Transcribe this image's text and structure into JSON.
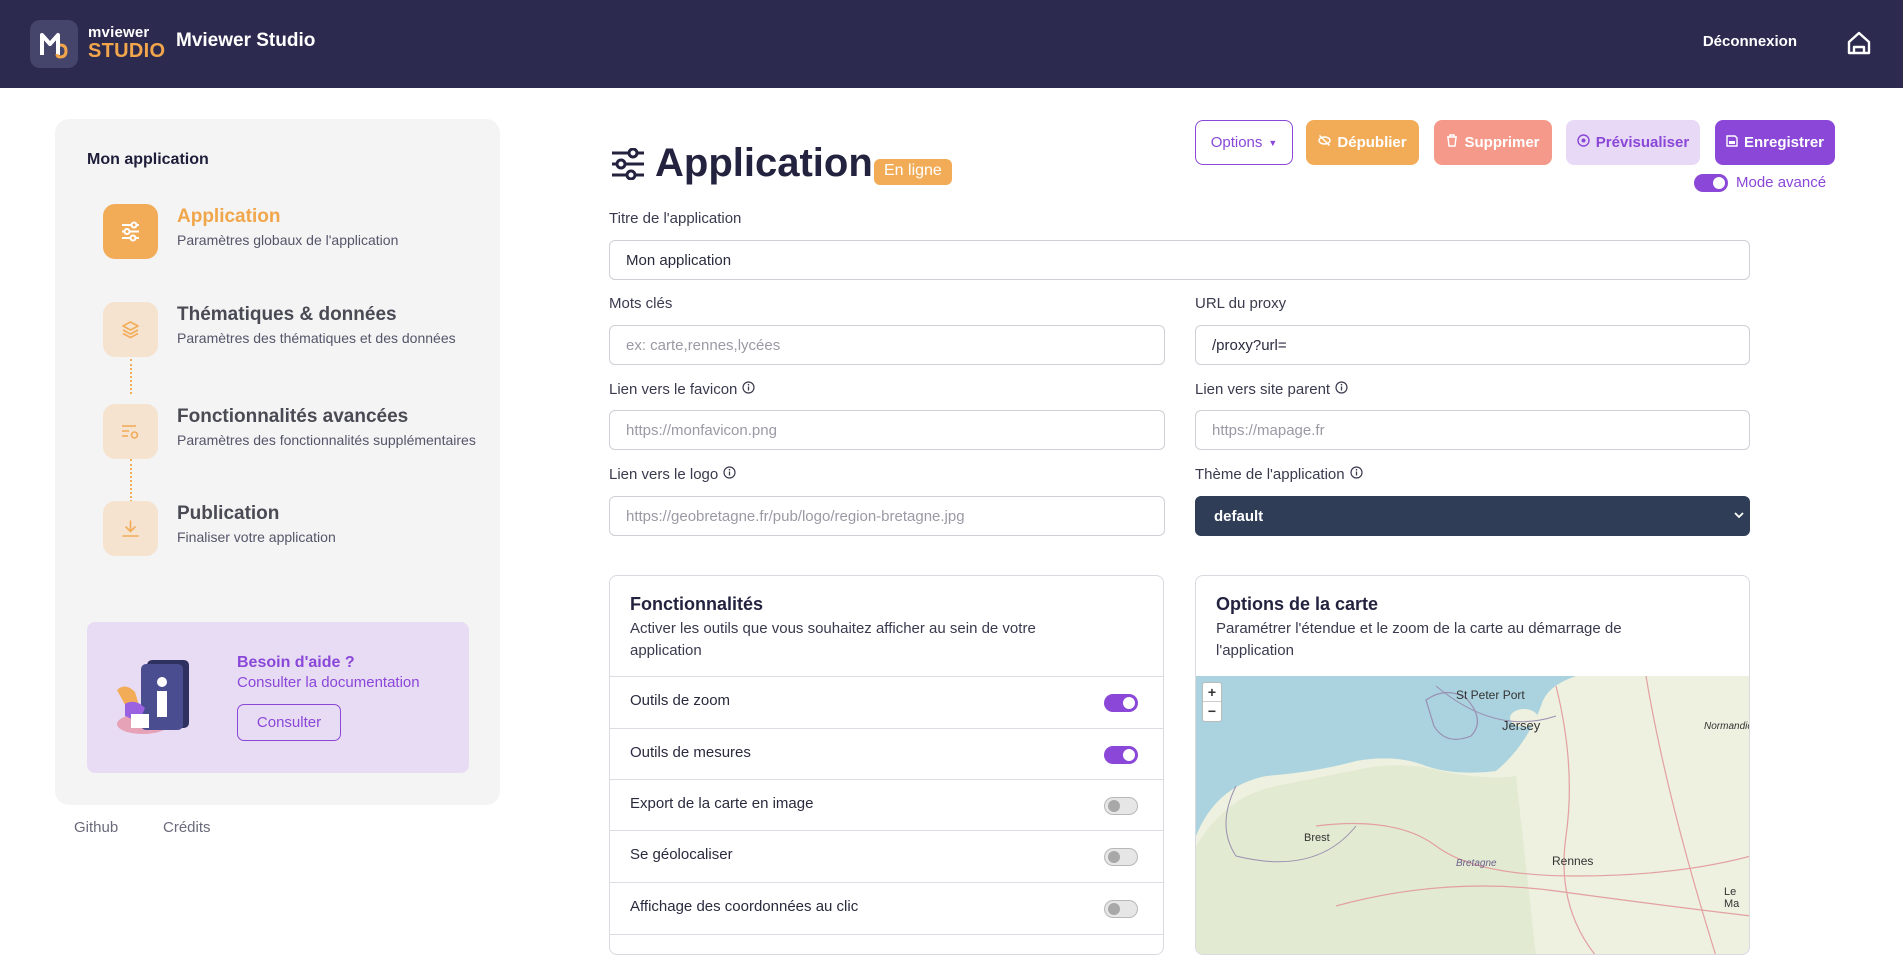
{
  "header": {
    "logo_top": "mviewer",
    "logo_bottom": "STUDIO",
    "app_name": "Mviewer Studio",
    "logout_label": "Déconnexion",
    "home_icon": "home-icon"
  },
  "sidebar": {
    "title": "Mon application",
    "steps": [
      {
        "title": "Application",
        "subtitle": "Paramètres globaux de l'application",
        "icon": "sliders-icon",
        "active": true
      },
      {
        "title": "Thématiques & données",
        "subtitle": "Paramètres des thématiques et des données",
        "icon": "layers-icon",
        "active": false
      },
      {
        "title": "Fonctionnalités avancées",
        "subtitle": "Paramètres des fonctionnalités supplémentaires",
        "icon": "advanced-settings-icon",
        "active": false
      },
      {
        "title": "Publication",
        "subtitle": "Finaliser votre application",
        "icon": "download-icon",
        "active": false
      }
    ],
    "help": {
      "title": "Besoin d'aide ?",
      "subtitle": "Consulter la documentation",
      "button_label": "Consulter"
    },
    "footer_links": [
      "Github",
      "Crédits"
    ]
  },
  "main": {
    "title": "Application",
    "status_badge": "En ligne",
    "toolbar": {
      "options_label": "Options",
      "unpublish_label": "Dépublier",
      "delete_label": "Supprimer",
      "preview_label": "Prévisualiser",
      "save_label": "Enregistrer"
    },
    "advanced_mode_label": "Mode avancé",
    "advanced_mode_on": true,
    "fields": {
      "app_title": {
        "label": "Titre de l'application",
        "value": "Mon application",
        "placeholder": ""
      },
      "keywords": {
        "label": "Mots clés",
        "value": "",
        "placeholder": "ex: carte,rennes,lycées"
      },
      "proxy_url": {
        "label": "URL du proxy",
        "value": "/proxy?url=",
        "placeholder": ""
      },
      "favicon": {
        "label": "Lien vers le favicon",
        "value": "",
        "placeholder": "https://monfavicon.png"
      },
      "parent_site": {
        "label": "Lien vers site parent",
        "value": "",
        "placeholder": "https://mapage.fr"
      },
      "logo": {
        "label": "Lien vers le logo",
        "value": "",
        "placeholder": "https://geobretagne.fr/pub/logo/region-bretagne.jpg"
      },
      "theme": {
        "label": "Thème de l'application",
        "value": "default"
      }
    },
    "features_card": {
      "title": "Fonctionnalités",
      "subtitle": "Activer les outils que vous souhaitez afficher au sein de votre application",
      "items": [
        {
          "label": "Outils de zoom",
          "enabled": true
        },
        {
          "label": "Outils de mesures",
          "enabled": true
        },
        {
          "label": "Export de la carte en image",
          "enabled": false
        },
        {
          "label": "Se géolocaliser",
          "enabled": false
        },
        {
          "label": "Affichage des coordonnées au clic",
          "enabled": false
        }
      ]
    },
    "map_card": {
      "title": "Options de la carte",
      "subtitle": "Paramétrer l'étendue et le zoom de la carte au démarrage de l'application",
      "zoom_in": "+",
      "zoom_out": "−",
      "places": [
        "St Peter Port",
        "Jersey",
        "Normandie",
        "Brest",
        "Bretagne",
        "Rennes",
        "Le Ma"
      ]
    }
  }
}
